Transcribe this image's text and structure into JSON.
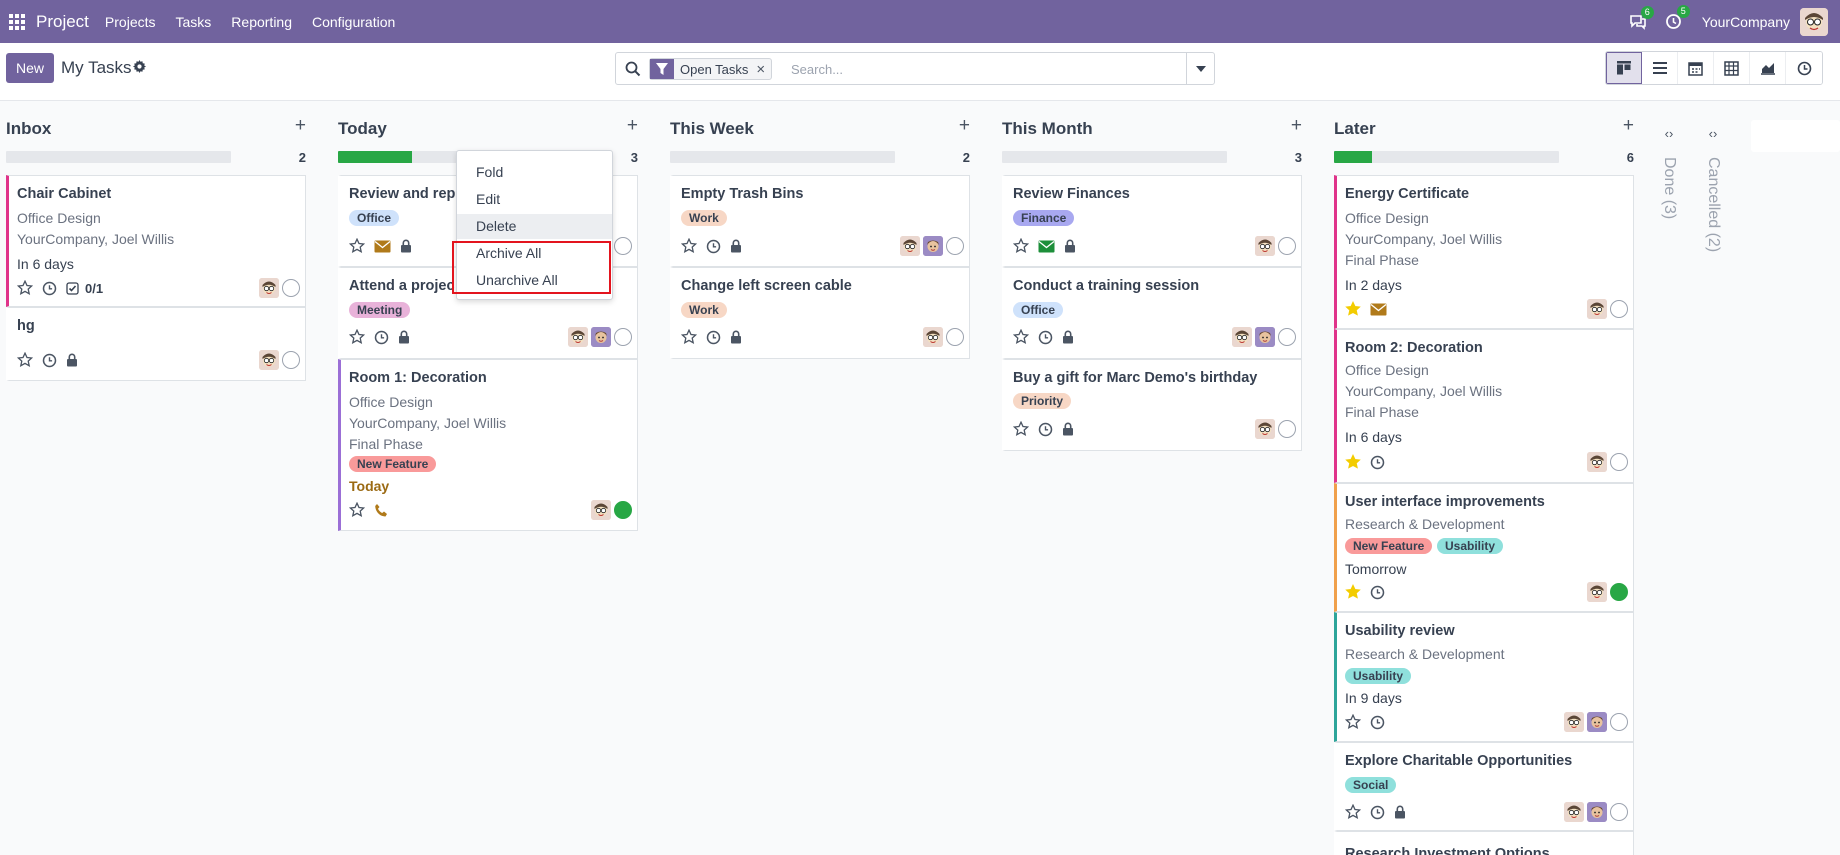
{
  "app": {
    "brand": "Project",
    "company": "YourCompany",
    "chat_badge": "6",
    "activity_badge": "5"
  },
  "nav": {
    "items": [
      "Projects",
      "Tasks",
      "Reporting",
      "Configuration"
    ]
  },
  "control": {
    "new_label": "New",
    "title": "My Tasks",
    "facet_label": "Open Tasks",
    "facet_close": "×",
    "search_placeholder": "Search...",
    "views": [
      "kanban-icon",
      "list-icon",
      "calendar-icon",
      "pivot-icon",
      "graph-icon",
      "activity-icon"
    ]
  },
  "columns": [
    {
      "title": "Inbox",
      "count": "2",
      "progress": 0
    },
    {
      "title": "Today",
      "count": "3",
      "progress": 0.33
    },
    {
      "title": "This Week",
      "count": "2",
      "progress": 0
    },
    {
      "title": "This Month",
      "count": "3",
      "progress": 0
    },
    {
      "title": "Later",
      "count": "6",
      "progress": 0.17
    }
  ],
  "folded": [
    {
      "label": "Done (3)"
    },
    {
      "label": "Cancelled (2)"
    }
  ],
  "cards": {
    "inbox": [
      {
        "title": "Chair Cabinet",
        "project": "Office Design",
        "customer": "YourCompany, Joel Willis",
        "deadline": "In 6 days",
        "subtasks": "0/1"
      },
      {
        "title": "hg"
      }
    ],
    "today": [
      {
        "title": "Review and rep",
        "tag": "Office"
      },
      {
        "title": "Attend a projec",
        "tag": "Meeting"
      },
      {
        "title": "Room 1: Decoration",
        "project": "Office Design",
        "customer": "YourCompany, Joel Willis",
        "stage": "Final Phase",
        "tag": "New Feature",
        "deadline": "Today"
      }
    ],
    "week": [
      {
        "title": "Empty Trash Bins",
        "tag": "Work"
      },
      {
        "title": "Change left screen cable",
        "tag": "Work"
      }
    ],
    "month": [
      {
        "title": "Review Finances",
        "tag": "Finance"
      },
      {
        "title": "Conduct a training session",
        "tag": "Office"
      },
      {
        "title": "Buy a gift for Marc Demo's birthday",
        "tag": "Priority"
      }
    ],
    "later": [
      {
        "title": "Energy Certificate",
        "project": "Office Design",
        "customer": "YourCompany, Joel Willis",
        "stage": "Final Phase",
        "deadline": "In 2 days"
      },
      {
        "title": "Room 2: Decoration",
        "project": "Office Design",
        "customer": "YourCompany, Joel Willis",
        "stage": "Final Phase",
        "deadline": "In 6 days"
      },
      {
        "title": "User interface improvements",
        "project": "Research & Development",
        "tags": [
          "New Feature",
          "Usability"
        ],
        "deadline": "Tomorrow"
      },
      {
        "title": "Usability review",
        "project": "Research & Development",
        "tag": "Usability",
        "deadline": "In 9 days"
      },
      {
        "title": "Explore Charitable Opportunities",
        "tag": "Social"
      },
      {
        "title": "Research Investment Options"
      }
    ]
  },
  "dropdown": {
    "items": [
      "Fold",
      "Edit",
      "Delete",
      "Archive All",
      "Unarchive All"
    ]
  },
  "colors": {
    "brand": "#71639e",
    "progress": "#28a745",
    "highlight": "#e3141e",
    "star_active": "#f3cc00"
  }
}
